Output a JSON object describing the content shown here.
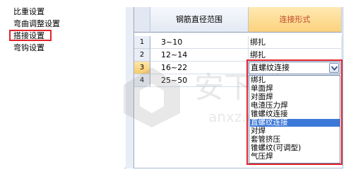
{
  "nav": {
    "items": [
      "比重设置",
      "弯曲调整设置",
      "搭接设置",
      "弯钩设置"
    ],
    "selected_index": 2
  },
  "table": {
    "headers": [
      "钢筋直径范围",
      "连接形式"
    ],
    "rows": [
      {
        "num": "1",
        "range": "3~10",
        "type": "绑扎"
      },
      {
        "num": "2",
        "range": "12~14",
        "type": "绑扎"
      },
      {
        "num": "3",
        "range": "16~22",
        "type": "直螺纹连接"
      },
      {
        "num": "4",
        "range": "25~50",
        "type": ""
      }
    ],
    "active_row": 3
  },
  "combo": {
    "value": "直螺纹连接",
    "options": [
      "绑扎",
      "单面焊",
      "对面焊",
      "电渣压力焊",
      "锥螺纹连接",
      "直螺纹连接",
      "对焊",
      "套管挤压",
      "锥螺纹(可调型)",
      "气压焊"
    ],
    "selected_index": 5
  },
  "watermark": {
    "text": "安下载",
    "subtext": "anxz.com"
  },
  "colors": {
    "highlight_border": "#e2242c",
    "selection": "#3c78d8",
    "header_accent": "#fbd27c"
  }
}
